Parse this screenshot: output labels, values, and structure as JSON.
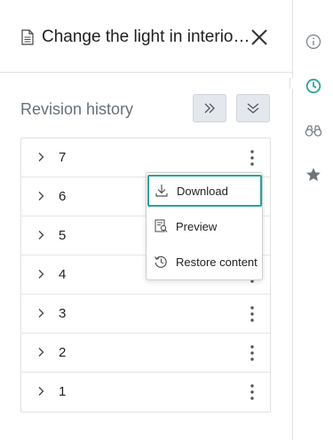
{
  "header": {
    "title": "Change the light in interior..."
  },
  "revision_history": {
    "title": "Revision history",
    "revisions": [
      {
        "number": "7"
      },
      {
        "number": "6"
      },
      {
        "number": "5"
      },
      {
        "number": "4"
      },
      {
        "number": "3"
      },
      {
        "number": "2"
      },
      {
        "number": "1"
      }
    ]
  },
  "context_menu": {
    "items": [
      {
        "label": "Download",
        "icon": "download-icon",
        "active": true
      },
      {
        "label": "Preview",
        "icon": "preview-icon"
      },
      {
        "label": "Restore content",
        "icon": "history-icon"
      }
    ]
  },
  "sidebar": {
    "items": [
      {
        "icon": "info-icon"
      },
      {
        "icon": "clock-icon",
        "active": true
      },
      {
        "icon": "binoculars-icon"
      },
      {
        "icon": "star-icon"
      }
    ]
  },
  "colors": {
    "accent": "#2aa29a",
    "section_title": "#66707a",
    "button_bg": "#e4e8ec"
  }
}
